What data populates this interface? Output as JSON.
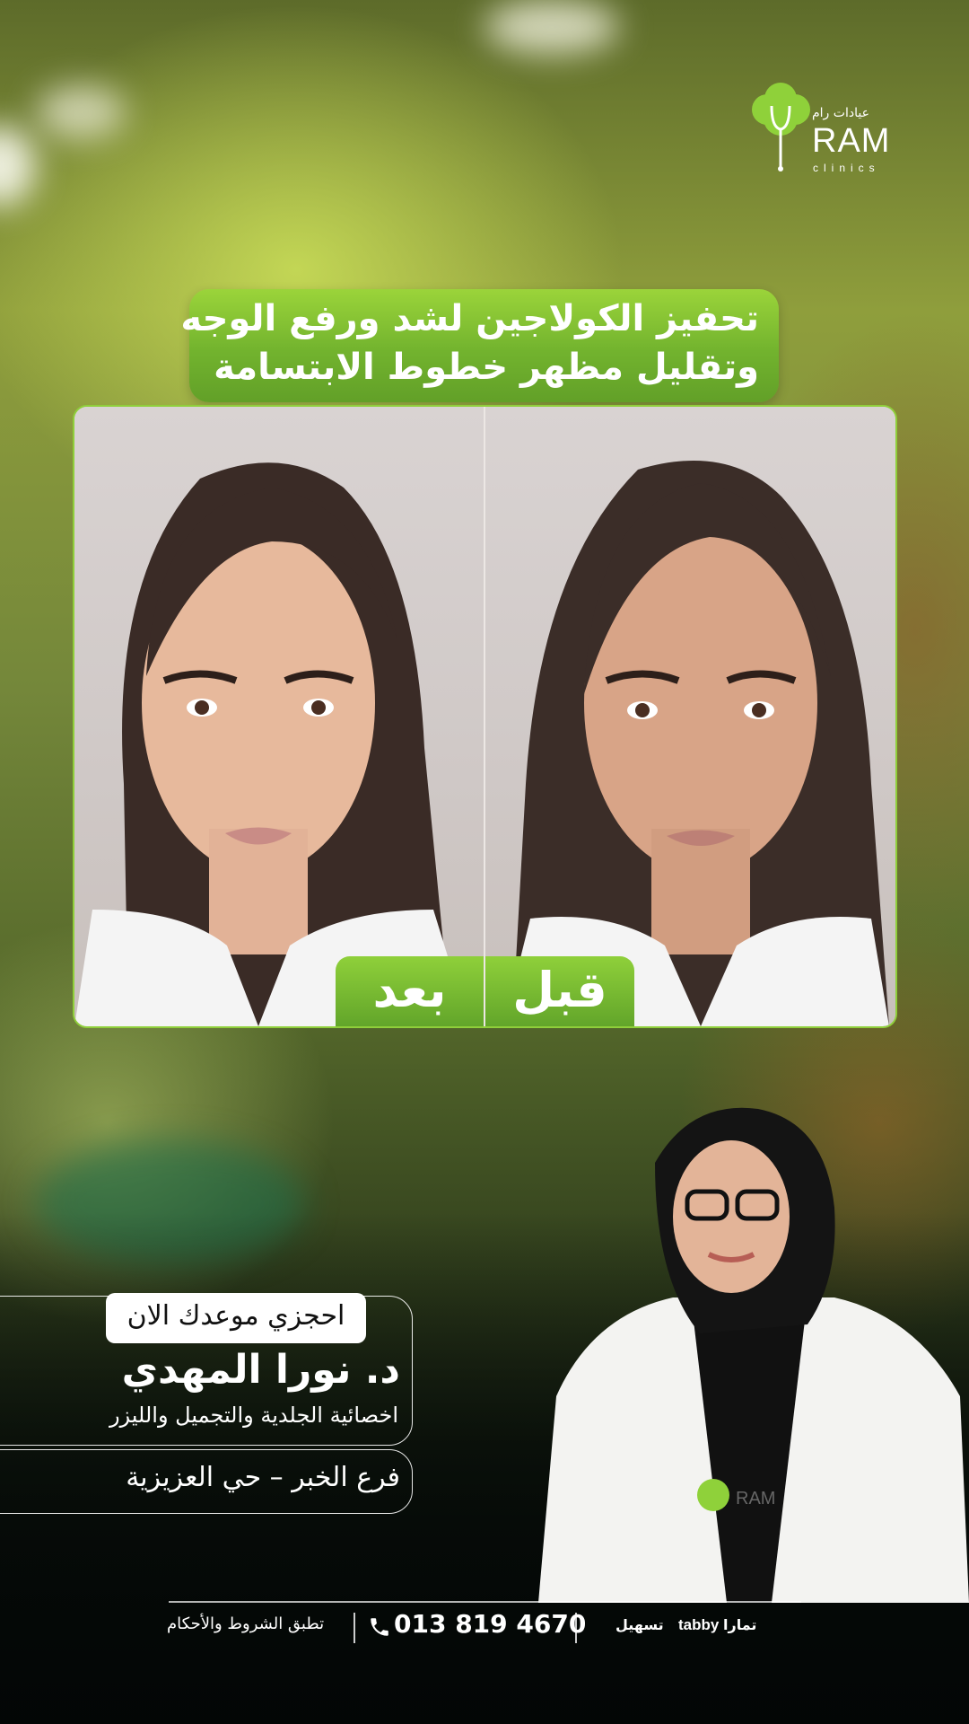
{
  "brand": {
    "name_ar": "عيادات رام",
    "name_en": "RAM",
    "sub_en": "clinics"
  },
  "headline": {
    "line1": "تحفيز الكولاجين لشد ورفع الوجه",
    "line2": "وتقليل مظهر خطوط الابتسامة"
  },
  "comparison": {
    "after_label": "بعد",
    "before_label": "قبل"
  },
  "booking": {
    "cta": "احجزي موعدك الان",
    "doctor_name": "د. نورا المهدي",
    "doctor_title": "اخصائية الجلدية والتجميل والليزر",
    "branch": "فرع الخبر – حي العزيزية"
  },
  "footer": {
    "terms": "تطبق الشروط والأحكام",
    "phone": "013 819 4670",
    "payments": [
      "تسهيل",
      "tabby",
      "تمارا"
    ]
  },
  "colors": {
    "accent_green": "#7cc234",
    "white": "#ffffff"
  }
}
